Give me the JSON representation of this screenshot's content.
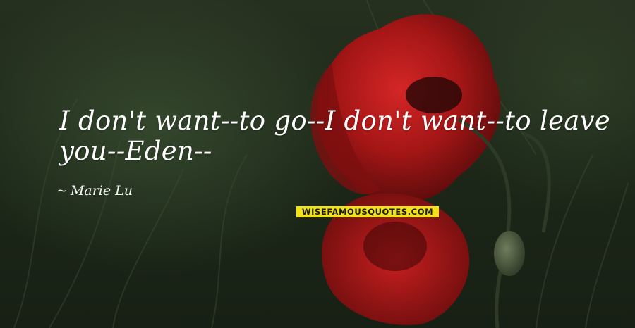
{
  "quote": {
    "text": "I don't want--to go--I don't want--to leave you--Eden--",
    "author": "Marie Lu",
    "author_prefix": "~"
  },
  "watermark": {
    "text": "WISEFAMOUSQUOTES.COM"
  },
  "colors": {
    "poppy_red": "#b01818",
    "grass_dark": "#1a2317",
    "quote_text": "#ffffff",
    "watermark_bg": "#f2e21a"
  }
}
